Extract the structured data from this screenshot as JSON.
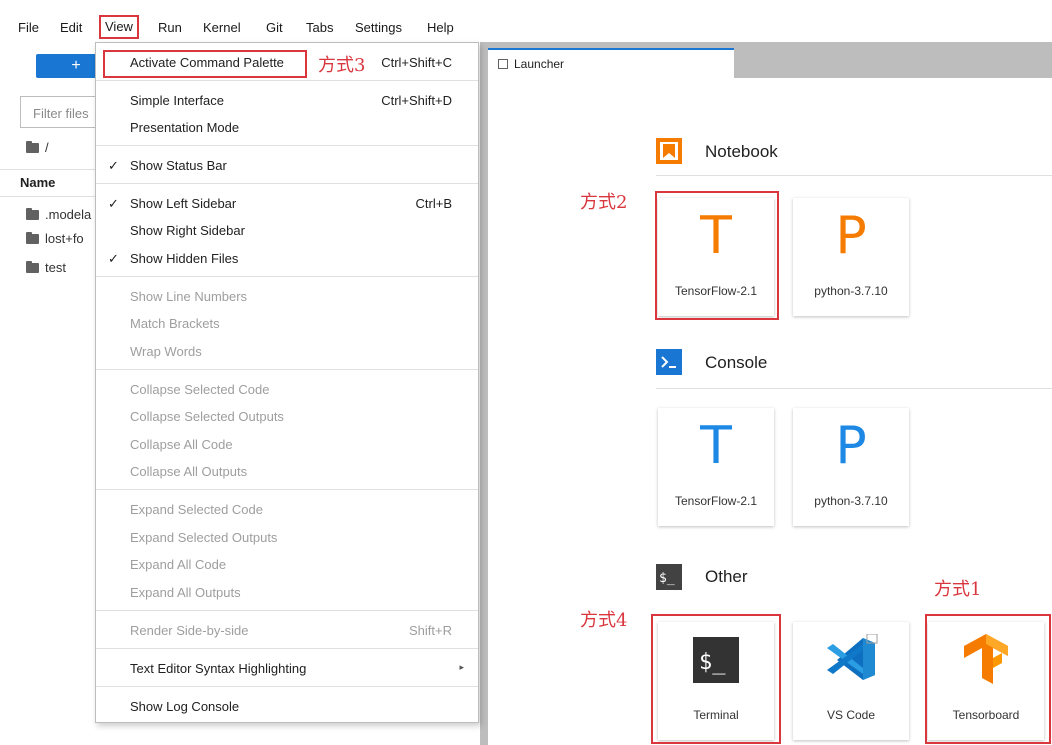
{
  "menubar": [
    "File",
    "Edit",
    "View",
    "Run",
    "Kernel",
    "Git",
    "Tabs",
    "Settings",
    "Help"
  ],
  "sidebar": {
    "new_label": "+",
    "filter_placeholder": "Filter files",
    "breadcrumb": "/",
    "column_header": "Name",
    "files": [
      ".modela",
      "lost+fo",
      "test"
    ]
  },
  "tab": {
    "label": "Launcher"
  },
  "launcher": {
    "sections": [
      {
        "title": "Notebook",
        "cards": [
          {
            "glyph": "T",
            "label": "TensorFlow-2.1"
          },
          {
            "glyph": "P",
            "label": "python-3.7.10"
          }
        ]
      },
      {
        "title": "Console",
        "cards": [
          {
            "glyph": "T",
            "label": "TensorFlow-2.1"
          },
          {
            "glyph": "P",
            "label": "python-3.7.10"
          }
        ]
      },
      {
        "title": "Other",
        "cards": [
          {
            "glyph": "$_",
            "label": "Terminal"
          },
          {
            "glyph": "vscode-icon",
            "label": "VS Code"
          },
          {
            "glyph": "tensorboard-icon",
            "label": "Tensorboard"
          }
        ]
      }
    ]
  },
  "view_menu": {
    "items": [
      {
        "label": "Activate Command Palette",
        "shortcut": "Ctrl+Shift+C"
      },
      {
        "label": "Simple Interface",
        "shortcut": "Ctrl+Shift+D"
      },
      {
        "label": "Presentation Mode",
        "shortcut": ""
      },
      {
        "label": "Show Status Bar",
        "shortcut": "",
        "checked": true
      },
      {
        "label": "Show Left Sidebar",
        "shortcut": "Ctrl+B",
        "checked": true
      },
      {
        "label": "Show Right Sidebar",
        "shortcut": ""
      },
      {
        "label": "Show Hidden Files",
        "shortcut": "",
        "checked": true
      },
      {
        "label": "Show Line Numbers",
        "shortcut": "",
        "disabled": true
      },
      {
        "label": "Match Brackets",
        "shortcut": "",
        "disabled": true
      },
      {
        "label": "Wrap Words",
        "shortcut": "",
        "disabled": true
      },
      {
        "label": "Collapse Selected Code",
        "shortcut": "",
        "disabled": true
      },
      {
        "label": "Collapse Selected Outputs",
        "shortcut": "",
        "disabled": true
      },
      {
        "label": "Collapse All Code",
        "shortcut": "",
        "disabled": true
      },
      {
        "label": "Collapse All Outputs",
        "shortcut": "",
        "disabled": true
      },
      {
        "label": "Expand Selected Code",
        "shortcut": "",
        "disabled": true
      },
      {
        "label": "Expand Selected Outputs",
        "shortcut": "",
        "disabled": true
      },
      {
        "label": "Expand All Code",
        "shortcut": "",
        "disabled": true
      },
      {
        "label": "Expand All Outputs",
        "shortcut": "",
        "disabled": true
      },
      {
        "label": "Render Side-by-side",
        "shortcut": "Shift+R",
        "disabled": true
      },
      {
        "label": "Text Editor Syntax Highlighting",
        "shortcut": "",
        "submenu": true
      },
      {
        "label": "Show Log Console",
        "shortcut": ""
      }
    ]
  },
  "annotations": {
    "a1": "方式1",
    "a2": "方式2",
    "a3": "方式3",
    "a4": "方式4"
  },
  "colors": {
    "accent": "#1976d2",
    "annotation": "#d9363e",
    "notebook_icon": "#f57c00",
    "console_icon": "#1976d2"
  }
}
